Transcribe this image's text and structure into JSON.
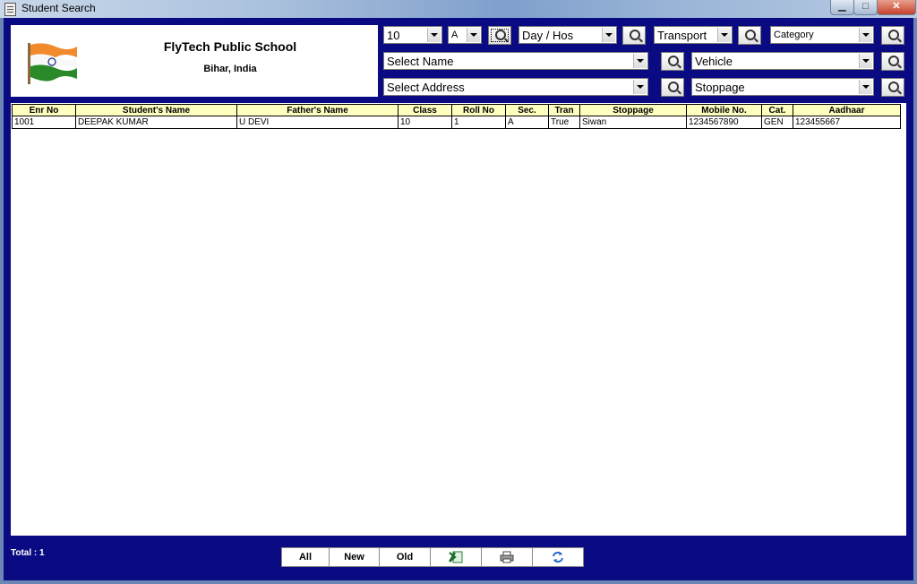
{
  "window": {
    "title": "Student Search"
  },
  "school": {
    "name": "FlyTech Public School",
    "location": "Bihar, India"
  },
  "filters": {
    "class_value": "10",
    "section_value": "A",
    "day_hos_value": "Day / Hos",
    "transport_value": "Transport",
    "category_value": "Category",
    "name_value": "Select Name",
    "vehicle_value": "Vehicle",
    "address_value": "Select Address",
    "stoppage_value": "Stoppage"
  },
  "table": {
    "columns": [
      "Enr No",
      "Student's Name",
      "Father's Name",
      "Class",
      "Roll No",
      "Sec.",
      "Tran",
      "Stoppage",
      "Mobile No.",
      "Cat.",
      "Aadhaar"
    ],
    "rows": [
      [
        "1001",
        "DEEPAK KUMAR",
        "U DEVI",
        "10",
        "1",
        "A",
        "True",
        "Siwan",
        "1234567890",
        "GEN",
        "123455667"
      ]
    ]
  },
  "footer": {
    "total": "Total : 1",
    "buttons": {
      "all": "All",
      "new": "New",
      "old": "Old"
    }
  },
  "colors": {
    "window_bg": "#0a0a82",
    "header_cell_bg": "#ffffc0"
  },
  "icons": [
    "window-icon",
    "flag-icon",
    "search-icon",
    "excel-icon",
    "printer-icon",
    "refresh-icon"
  ]
}
